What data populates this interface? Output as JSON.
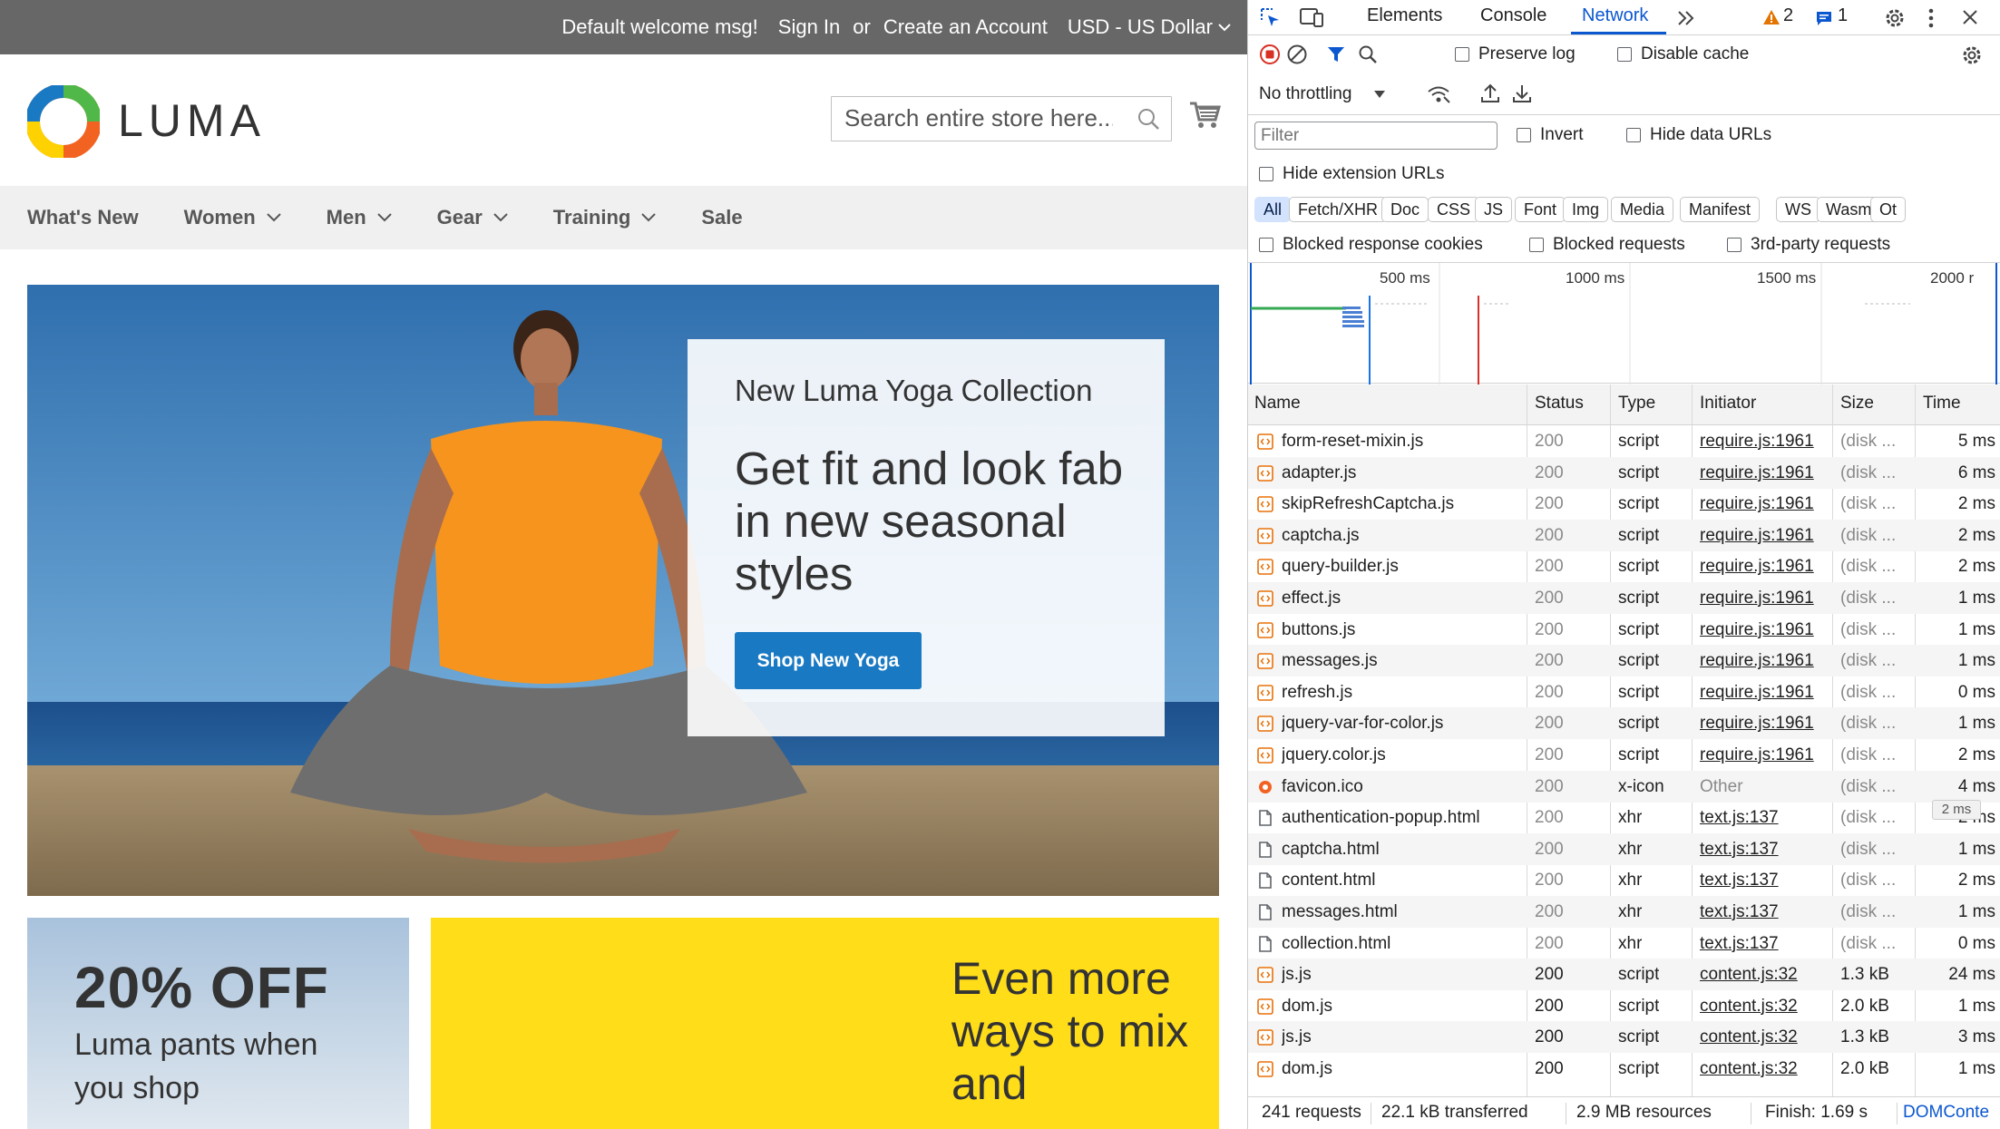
{
  "store": {
    "topbar": {
      "welcome": "Default welcome msg!",
      "sign_in": "Sign In",
      "or": "or",
      "create_account": "Create an Account",
      "currency": "USD - US Dollar"
    },
    "logo_text": "LUMA",
    "search_placeholder": "Search entire store here...",
    "nav": [
      {
        "label": "What's New",
        "has_dropdown": false
      },
      {
        "label": "Women",
        "has_dropdown": true
      },
      {
        "label": "Men",
        "has_dropdown": true
      },
      {
        "label": "Gear",
        "has_dropdown": true
      },
      {
        "label": "Training",
        "has_dropdown": true
      },
      {
        "label": "Sale",
        "has_dropdown": false
      }
    ],
    "hero": {
      "subtitle": "New Luma Yoga Collection",
      "title": "Get fit and look fab in new seasonal styles",
      "button": "Shop New Yoga"
    },
    "promo_left": {
      "headline": "20% OFF",
      "text": "Luma pants when you shop"
    },
    "promo_right": {
      "text": "Even more ways to mix and"
    },
    "colors": {
      "button_blue": "#1979c3",
      "topbar": "#676767",
      "promo_yellow": "#ffdd19"
    }
  },
  "devtools": {
    "tabs": [
      "Elements",
      "Console",
      "Network"
    ],
    "active_tab": "Network",
    "warnings": "2",
    "messages": "1",
    "preserve_log": "Preserve log",
    "disable_cache": "Disable cache",
    "throttling": "No throttling",
    "filter_placeholder": "Filter",
    "invert": "Invert",
    "hide_data_urls": "Hide data URLs",
    "hide_extension_urls": "Hide extension URLs",
    "type_filters": [
      "All",
      "Fetch/XHR",
      "Doc",
      "CSS",
      "JS",
      "Font",
      "Img",
      "Media",
      "Manifest",
      "WS",
      "Wasm",
      "Ot"
    ],
    "active_type": "All",
    "blocked_cookies": "Blocked response cookies",
    "blocked_requests": "Blocked requests",
    "third_party": "3rd-party requests",
    "timeline_labels": [
      "500 ms",
      "1000 ms",
      "1500 ms",
      "2000 r"
    ],
    "columns": {
      "name": "Name",
      "status": "Status",
      "type": "Type",
      "initiator": "Initiator",
      "size": "Size",
      "time": "Time"
    },
    "rows": [
      {
        "name": "form-reset-mixin.js",
        "status": "200",
        "type": "script",
        "initiator": "require.js:1961",
        "size": "(disk ...",
        "time": "5 ms",
        "icon": "script-icon",
        "cached": true
      },
      {
        "name": "adapter.js",
        "status": "200",
        "type": "script",
        "initiator": "require.js:1961",
        "size": "(disk ...",
        "time": "6 ms",
        "icon": "script-icon",
        "cached": true
      },
      {
        "name": "skipRefreshCaptcha.js",
        "status": "200",
        "type": "script",
        "initiator": "require.js:1961",
        "size": "(disk ...",
        "time": "2 ms",
        "icon": "script-icon",
        "cached": true
      },
      {
        "name": "captcha.js",
        "status": "200",
        "type": "script",
        "initiator": "require.js:1961",
        "size": "(disk ...",
        "time": "2 ms",
        "icon": "script-icon",
        "cached": true
      },
      {
        "name": "query-builder.js",
        "status": "200",
        "type": "script",
        "initiator": "require.js:1961",
        "size": "(disk ...",
        "time": "2 ms",
        "icon": "script-icon",
        "cached": true
      },
      {
        "name": "effect.js",
        "status": "200",
        "type": "script",
        "initiator": "require.js:1961",
        "size": "(disk ...",
        "time": "1 ms",
        "icon": "script-icon",
        "cached": true
      },
      {
        "name": "buttons.js",
        "status": "200",
        "type": "script",
        "initiator": "require.js:1961",
        "size": "(disk ...",
        "time": "1 ms",
        "icon": "script-icon",
        "cached": true
      },
      {
        "name": "messages.js",
        "status": "200",
        "type": "script",
        "initiator": "require.js:1961",
        "size": "(disk ...",
        "time": "1 ms",
        "icon": "script-icon",
        "cached": true
      },
      {
        "name": "refresh.js",
        "status": "200",
        "type": "script",
        "initiator": "require.js:1961",
        "size": "(disk ...",
        "time": "0 ms",
        "icon": "script-icon",
        "cached": true
      },
      {
        "name": "jquery-var-for-color.js",
        "status": "200",
        "type": "script",
        "initiator": "require.js:1961",
        "size": "(disk ...",
        "time": "1 ms",
        "icon": "script-icon",
        "cached": true
      },
      {
        "name": "jquery.color.js",
        "status": "200",
        "type": "script",
        "initiator": "require.js:1961",
        "size": "(disk ...",
        "time": "2 ms",
        "icon": "script-icon",
        "cached": true
      },
      {
        "name": "favicon.ico",
        "status": "200",
        "type": "x-icon",
        "initiator": "Other",
        "size": "(disk ...",
        "time": "4 ms",
        "icon": "favicon-icon",
        "cached": true
      },
      {
        "name": "authentication-popup.html",
        "status": "200",
        "type": "xhr",
        "initiator": "text.js:137",
        "size": "(disk ...",
        "time": "2 ms",
        "icon": "document-icon",
        "cached": true
      },
      {
        "name": "captcha.html",
        "status": "200",
        "type": "xhr",
        "initiator": "text.js:137",
        "size": "(disk ...",
        "time": "1 ms",
        "icon": "document-icon",
        "cached": true
      },
      {
        "name": "content.html",
        "status": "200",
        "type": "xhr",
        "initiator": "text.js:137",
        "size": "(disk ...",
        "time": "2 ms",
        "icon": "document-icon",
        "cached": true
      },
      {
        "name": "messages.html",
        "status": "200",
        "type": "xhr",
        "initiator": "text.js:137",
        "size": "(disk ...",
        "time": "1 ms",
        "icon": "document-icon",
        "cached": true
      },
      {
        "name": "collection.html",
        "status": "200",
        "type": "xhr",
        "initiator": "text.js:137",
        "size": "(disk ...",
        "time": "0 ms",
        "icon": "document-icon",
        "cached": true
      },
      {
        "name": "js.js",
        "status": "200",
        "type": "script",
        "initiator": "content.js:32",
        "size": "1.3 kB",
        "time": "24 ms",
        "icon": "script-icon",
        "cached": false
      },
      {
        "name": "dom.js",
        "status": "200",
        "type": "script",
        "initiator": "content.js:32",
        "size": "2.0 kB",
        "time": "1 ms",
        "icon": "script-icon",
        "cached": false
      },
      {
        "name": "js.js",
        "status": "200",
        "type": "script",
        "initiator": "content.js:32",
        "size": "1.3 kB",
        "time": "3 ms",
        "icon": "script-icon",
        "cached": false
      },
      {
        "name": "dom.js",
        "status": "200",
        "type": "script",
        "initiator": "content.js:32",
        "size": "2.0 kB",
        "time": "1 ms",
        "icon": "script-icon",
        "cached": false
      }
    ],
    "tooltip": "2 ms",
    "status": {
      "requests": "241 requests",
      "transferred": "22.1 kB transferred",
      "resources": "2.9 MB resources",
      "finish": "Finish: 1.69 s",
      "dom": "DOMConte"
    },
    "colors": {
      "accent": "#0b57d0",
      "record_red": "#d93025",
      "warning": "#e37400"
    }
  }
}
